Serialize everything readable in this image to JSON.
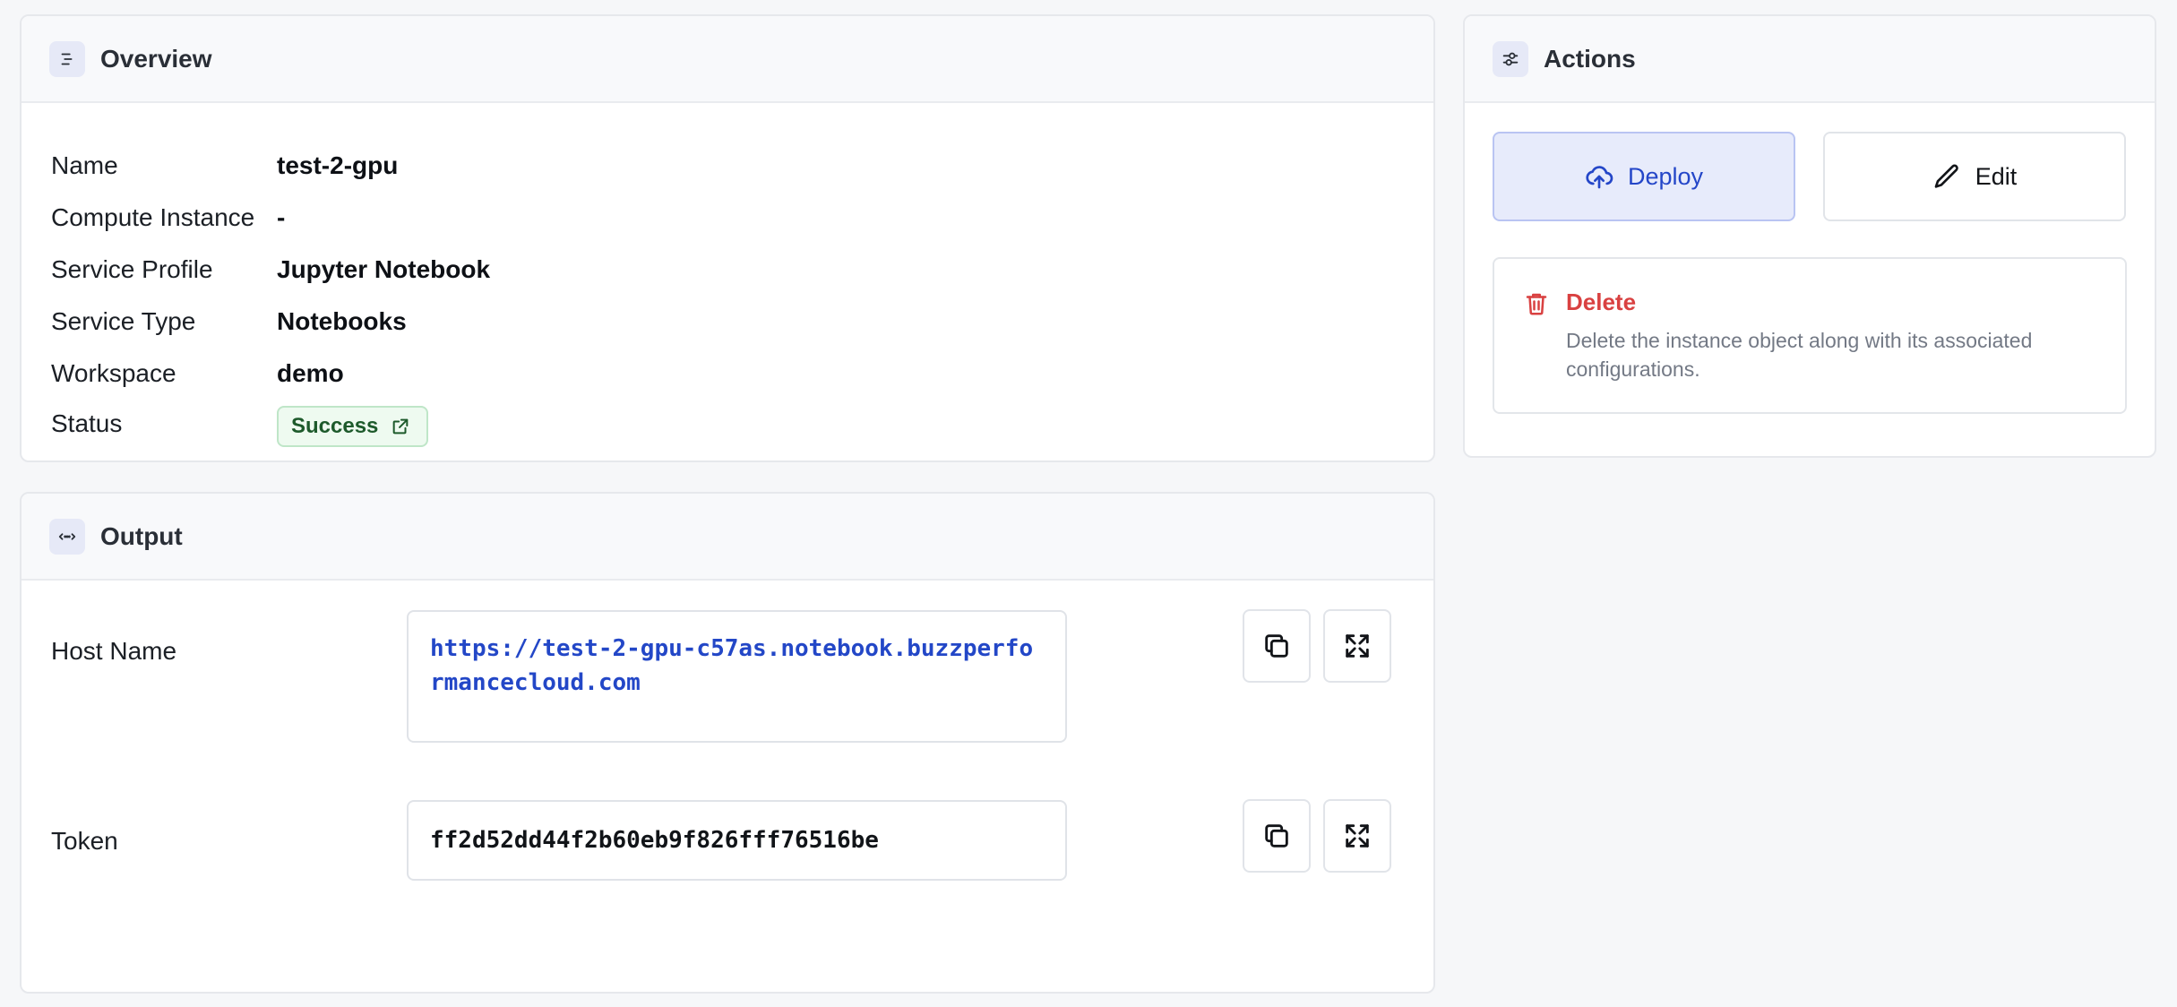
{
  "overview": {
    "title": "Overview",
    "icon": "list-icon",
    "rows": [
      {
        "label": "Name",
        "value": "test-2-gpu"
      },
      {
        "label": "Compute Instance",
        "value": "-"
      },
      {
        "label": "Service Profile",
        "value": "Jupyter Notebook"
      },
      {
        "label": "Service Type",
        "value": "Notebooks"
      },
      {
        "label": "Workspace",
        "value": "demo"
      }
    ],
    "status": {
      "label": "Status",
      "value": "Success",
      "icon": "external-link-icon",
      "color": "#1d5a2b",
      "background": "#eefaf0"
    }
  },
  "actions": {
    "title": "Actions",
    "icon": "sliders-icon",
    "deploy": {
      "label": "Deploy",
      "icon": "cloud-upload-icon",
      "color": "#2446c8"
    },
    "edit": {
      "label": "Edit",
      "icon": "pencil-icon"
    },
    "delete": {
      "title": "Delete",
      "icon": "trash-icon",
      "description": "Delete the instance object along with its associated configurations.",
      "color": "#d94141"
    }
  },
  "output": {
    "title": "Output",
    "icon": "code-arrows-icon",
    "host_name": {
      "label": "Host Name",
      "value": "https://test-2-gpu-c57as.notebook.buzzperformancecloud.com"
    },
    "token": {
      "label": "Token",
      "value": "ff2d52dd44f2b60eb9f826fff76516be"
    },
    "copy_icon": "copy-icon",
    "expand_icon": "expand-icon"
  }
}
